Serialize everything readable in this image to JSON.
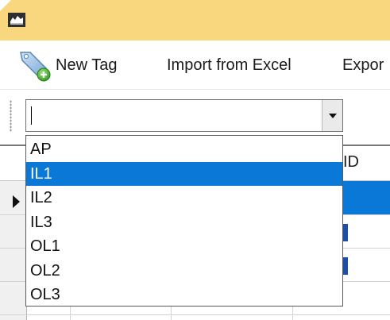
{
  "toolbar": {
    "new_tag_label": "New Tag",
    "import_label": "Import from Excel",
    "export_label": "Expor"
  },
  "filter_combo": {
    "value": ""
  },
  "grid": {
    "visible_header": "ID"
  },
  "dropdown": {
    "options": [
      "AP",
      "IL1",
      "IL2",
      "IL3",
      "OL1",
      "OL2",
      "OL3"
    ],
    "selected_index": 1
  },
  "colors": {
    "title_bar": "#f8d77f",
    "selection": "#0a78d7"
  },
  "icons": [
    "app-icon",
    "tag-add-icon",
    "grip-icon",
    "dropdown-arrow-icon",
    "row-pointer-icon"
  ]
}
